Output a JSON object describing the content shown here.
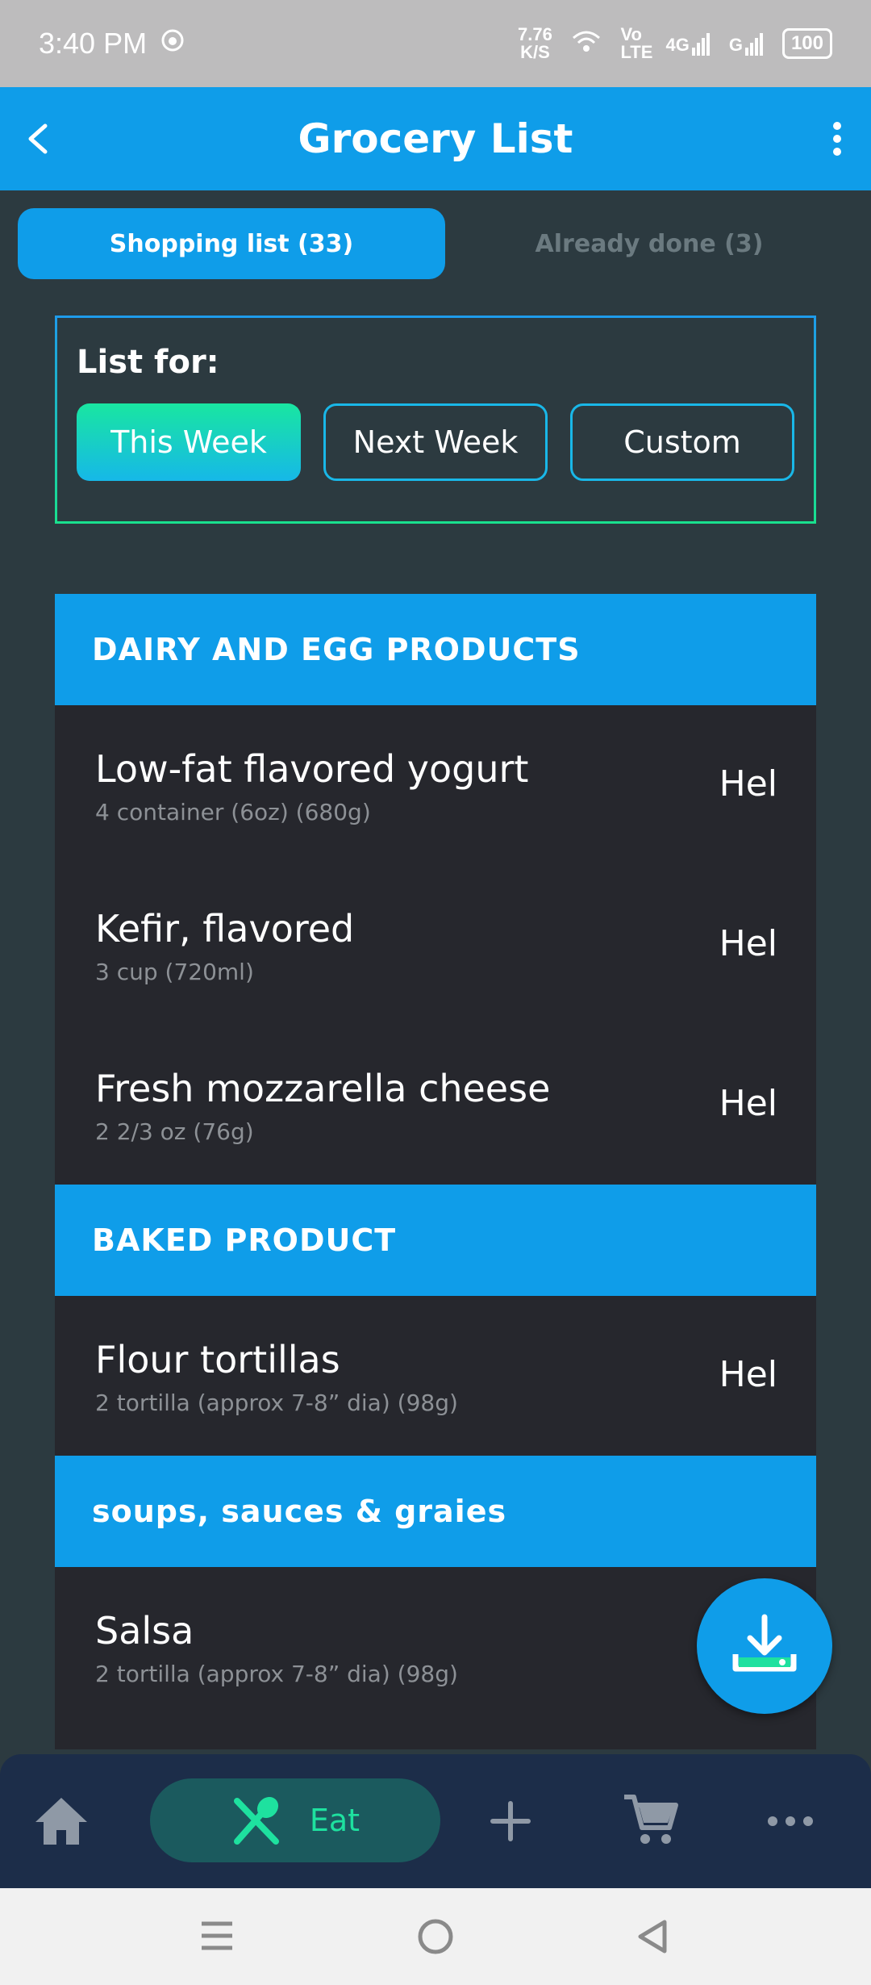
{
  "status_bar": {
    "time": "3:40 PM",
    "net_speed": "7.76 K/S",
    "volte": "Vo LTE",
    "network_4g": "4G",
    "network_g": "G",
    "battery": "100"
  },
  "header": {
    "title": "Grocery List"
  },
  "tabs": [
    {
      "label": "Shopping list (33)",
      "active": true
    },
    {
      "label": "Already done (3)",
      "active": false
    }
  ],
  "list_for": {
    "label": "List for:",
    "options": [
      {
        "label": "This Week",
        "selected": true
      },
      {
        "label": "Next Week",
        "selected": false
      },
      {
        "label": "Custom",
        "selected": false
      }
    ]
  },
  "categories": [
    {
      "title": "DAIRY AND EGG PRODUCTS",
      "items": [
        {
          "name": "Low-fat flavored yogurt",
          "qty": "4 container (6oz) (680g)",
          "action": "Hel"
        },
        {
          "name": "Kefir, flavored",
          "qty": "3 cup (720ml)",
          "action": "Hel"
        },
        {
          "name": "Fresh mozzarella cheese",
          "qty": "2 2/3 oz (76g)",
          "action": "Hel"
        }
      ]
    },
    {
      "title": "BAKED PRODUCT",
      "items": [
        {
          "name": "Flour tortillas",
          "qty": "2 tortilla (approx 7-8” dia) (98g)",
          "action": "Hel"
        }
      ]
    },
    {
      "title": "soups, sauces & graies",
      "items": [
        {
          "name": "Salsa",
          "qty": "2 tortilla (approx 7-8” dia) (98g)",
          "action": ""
        }
      ]
    }
  ],
  "bottom_nav": {
    "items": [
      {
        "icon": "home-icon"
      },
      {
        "icon": "fork-knife-icon",
        "label": "Eat",
        "active": true
      },
      {
        "icon": "plus-icon"
      },
      {
        "icon": "cart-icon"
      },
      {
        "icon": "more-icon"
      }
    ]
  },
  "colors": {
    "primary": "#0f9de9",
    "accent": "#1ee19f",
    "background": "#2c3a40",
    "item_bg": "#26272d"
  }
}
